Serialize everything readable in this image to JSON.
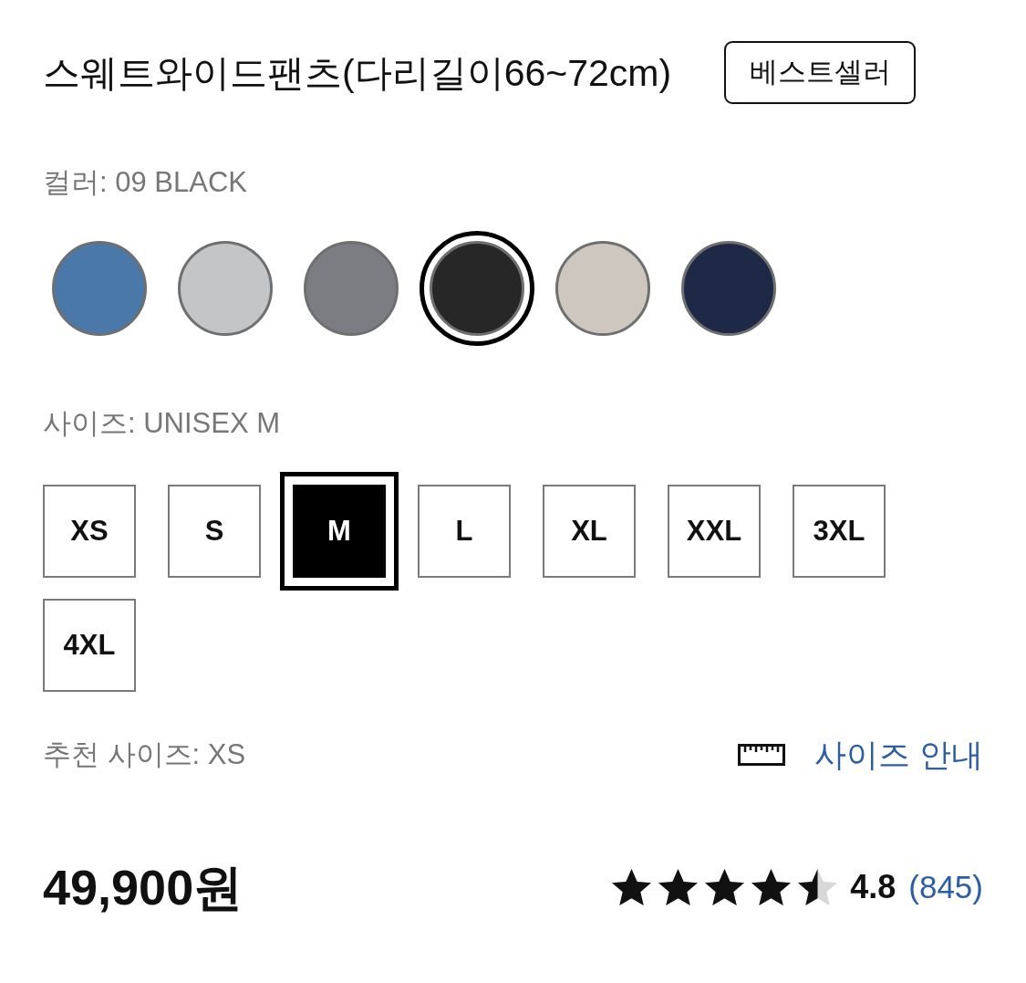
{
  "product": {
    "title": "스웨트와이드팬츠(다리길이66~72cm)",
    "badge": "베스트셀러"
  },
  "color_label": "컬러: 09 BLACK",
  "colors": [
    {
      "color": "#4a78a8",
      "selected": false
    },
    {
      "color": "#c3c5c7",
      "selected": false
    },
    {
      "color": "#7b7d83",
      "selected": false
    },
    {
      "color": "#272727",
      "selected": true
    },
    {
      "color": "#cdc7c0",
      "selected": false
    },
    {
      "color": "#1e2947",
      "selected": false
    }
  ],
  "size_label": "사이즈: UNISEX M",
  "sizes": [
    {
      "label": "XS",
      "selected": false
    },
    {
      "label": "S",
      "selected": false
    },
    {
      "label": "M",
      "selected": true
    },
    {
      "label": "L",
      "selected": false
    },
    {
      "label": "XL",
      "selected": false
    },
    {
      "label": "XXL",
      "selected": false
    },
    {
      "label": "3XL",
      "selected": false
    },
    {
      "label": "4XL",
      "selected": false
    }
  ],
  "recommended_size": "추천 사이즈: XS",
  "size_guide": {
    "label": "사이즈 안내"
  },
  "price": "49,900원",
  "rating": {
    "stars": 4.5,
    "score": "4.8",
    "count": "(845)"
  }
}
